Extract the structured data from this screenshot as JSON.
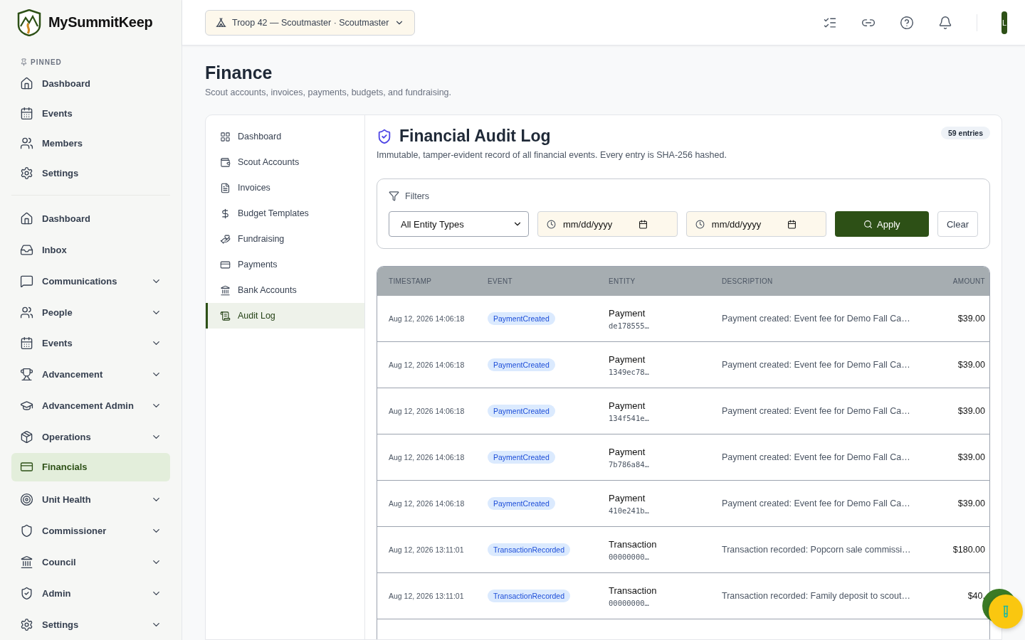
{
  "brand": {
    "name": "MySummitKeep"
  },
  "pinned": {
    "heading": "PINNED",
    "items": [
      {
        "label": "Dashboard",
        "selected": false
      },
      {
        "label": "Events",
        "selected": false
      },
      {
        "label": "Members",
        "selected": false
      },
      {
        "label": "Settings",
        "selected": false
      }
    ]
  },
  "nav": [
    {
      "label": "Dashboard",
      "expandable": false,
      "selected": false
    },
    {
      "label": "Inbox",
      "expandable": false,
      "selected": false
    },
    {
      "label": "Communications",
      "expandable": true,
      "selected": false
    },
    {
      "label": "People",
      "expandable": true,
      "selected": false
    },
    {
      "label": "Events",
      "expandable": true,
      "selected": false
    },
    {
      "label": "Advancement",
      "expandable": true,
      "selected": false
    },
    {
      "label": "Advancement Admin",
      "expandable": true,
      "selected": false
    },
    {
      "label": "Operations",
      "expandable": true,
      "selected": false
    },
    {
      "label": "Financials",
      "expandable": false,
      "selected": true
    },
    {
      "label": "Unit Health",
      "expandable": true,
      "selected": false
    },
    {
      "label": "Commissioner",
      "expandable": true,
      "selected": false
    },
    {
      "label": "Council",
      "expandable": true,
      "selected": false
    },
    {
      "label": "Admin",
      "expandable": true,
      "selected": false
    },
    {
      "label": "Settings",
      "expandable": true,
      "selected": false
    }
  ],
  "unit_switcher": {
    "label": "Troop 42 — Scoutmaster · Scoutmaster"
  },
  "avatar": {
    "initial": "L"
  },
  "page": {
    "title": "Finance",
    "subtitle": "Scout accounts, invoices, payments, budgets, and fundraising."
  },
  "subnav": [
    {
      "label": "Dashboard",
      "selected": false
    },
    {
      "label": "Scout Accounts",
      "selected": false
    },
    {
      "label": "Invoices",
      "selected": false
    },
    {
      "label": "Budget Templates",
      "selected": false
    },
    {
      "label": "Fundraising",
      "selected": false
    },
    {
      "label": "Payments",
      "selected": false
    },
    {
      "label": "Bank Accounts",
      "selected": false
    },
    {
      "label": "Audit Log",
      "selected": true
    }
  ],
  "audit": {
    "title": "Financial Audit Log",
    "count": "59 entries",
    "description": "Immutable, tamper-evident record of all financial events. Every entry is SHA-256 hashed."
  },
  "filters": {
    "heading": "Filters",
    "entity_type": "All Entity Types",
    "date_from": {
      "placeholder": "mm/dd/yyyy"
    },
    "date_to": {
      "placeholder": "mm/dd/yyyy"
    },
    "apply": "Apply",
    "clear": "Clear"
  },
  "table": {
    "columns": [
      "TIMESTAMP",
      "EVENT",
      "ENTITY",
      "DESCRIPTION",
      "AMOUNT"
    ],
    "rows": [
      {
        "timestamp": "Aug 12, 2026 14:06:18",
        "event": "PaymentCreated",
        "entity": "Payment",
        "entity_id": "de178555…",
        "description": "Payment created: Event fee for Demo Fall Ca…",
        "amount": "$39.00"
      },
      {
        "timestamp": "Aug 12, 2026 14:06:18",
        "event": "PaymentCreated",
        "entity": "Payment",
        "entity_id": "1349ec78…",
        "description": "Payment created: Event fee for Demo Fall Ca…",
        "amount": "$39.00"
      },
      {
        "timestamp": "Aug 12, 2026 14:06:18",
        "event": "PaymentCreated",
        "entity": "Payment",
        "entity_id": "134f541e…",
        "description": "Payment created: Event fee for Demo Fall Ca…",
        "amount": "$39.00"
      },
      {
        "timestamp": "Aug 12, 2026 14:06:18",
        "event": "PaymentCreated",
        "entity": "Payment",
        "entity_id": "7b786a84…",
        "description": "Payment created: Event fee for Demo Fall Ca…",
        "amount": "$39.00"
      },
      {
        "timestamp": "Aug 12, 2026 14:06:18",
        "event": "PaymentCreated",
        "entity": "Payment",
        "entity_id": "410e241b…",
        "description": "Payment created: Event fee for Demo Fall Ca…",
        "amount": "$39.00"
      },
      {
        "timestamp": "Aug 12, 2026 13:11:01",
        "event": "TransactionRecorded",
        "entity": "Transaction",
        "entity_id": "00000000…",
        "description": "Transaction recorded: Popcorn sale commissi…",
        "amount": "$180.00"
      },
      {
        "timestamp": "Aug 12, 2026 13:11:01",
        "event": "TransactionRecorded",
        "entity": "Transaction",
        "entity_id": "00000000…",
        "description": "Transaction recorded: Family deposit to scout…",
        "amount": "$40."
      }
    ]
  }
}
